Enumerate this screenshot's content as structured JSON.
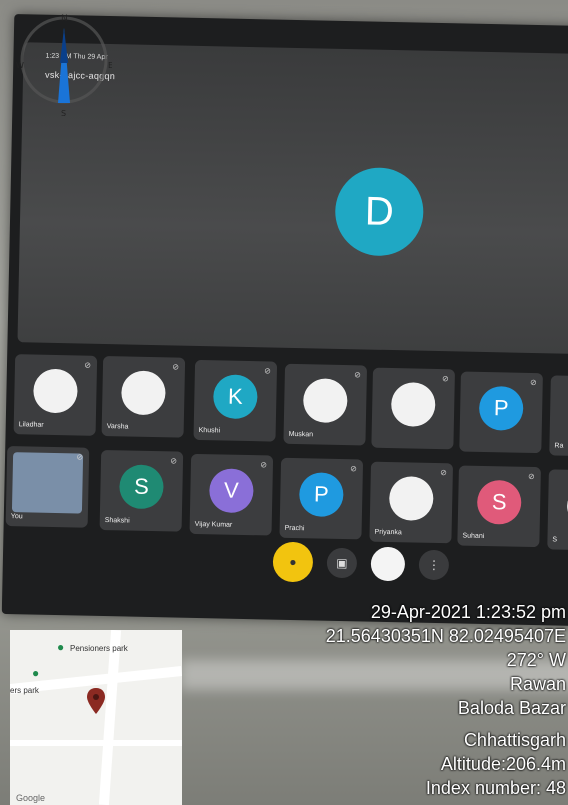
{
  "meeting": {
    "time_small": "1:23 PM",
    "date_small": "Thu 29 Apr",
    "meeting_code": "vsk-bajcc-aqgqn",
    "presenter_initial": "D"
  },
  "participants": [
    {
      "name": "Liladhar",
      "initial": "",
      "color": "#f2f2f2"
    },
    {
      "name": "Varsha",
      "initial": "",
      "color": "#f2f2f2"
    },
    {
      "name": "Khushi",
      "initial": "K",
      "color": "#1fa8c4"
    },
    {
      "name": "Muskan",
      "initial": "",
      "color": "#f2f2f2"
    },
    {
      "name": "",
      "initial": "",
      "color": "#f2f2f2"
    },
    {
      "name": "",
      "initial": "P",
      "color": "#1f9ae0"
    },
    {
      "name": "Ra",
      "initial": "",
      "color": "#f2f2f2"
    },
    {
      "name": "You",
      "initial": "",
      "color": "#7a8fa8"
    },
    {
      "name": "Shakshi",
      "initial": "S",
      "color": "#1f8a73"
    },
    {
      "name": "Vijay Kumar",
      "initial": "V",
      "color": "#8a6fd8"
    },
    {
      "name": "Prachi",
      "initial": "P",
      "color": "#1f9ae0"
    },
    {
      "name": "Priyanka",
      "initial": "",
      "color": "#f2f2f2"
    },
    {
      "name": "Suhani",
      "initial": "S",
      "color": "#e05a7a"
    },
    {
      "name": "S",
      "initial": "",
      "color": "#f2f2f2"
    }
  ],
  "controls": [
    {
      "name": "mic-button"
    },
    {
      "name": "camera-button"
    },
    {
      "name": "present-button"
    },
    {
      "name": "more-button"
    }
  ],
  "map": {
    "label1": "Pensioners park",
    "label2": "ers park",
    "google": "Google"
  },
  "geo": {
    "datetime": "29-Apr-2021 1:23:52 pm",
    "coords": "21.56430351N 82.02495407E",
    "heading": "272° W",
    "place": "Rawan",
    "district": "Baloda Bazar",
    "state": "Chhattisgarh",
    "altitude": "Altitude:206.4m",
    "index": "Index number: 48"
  }
}
